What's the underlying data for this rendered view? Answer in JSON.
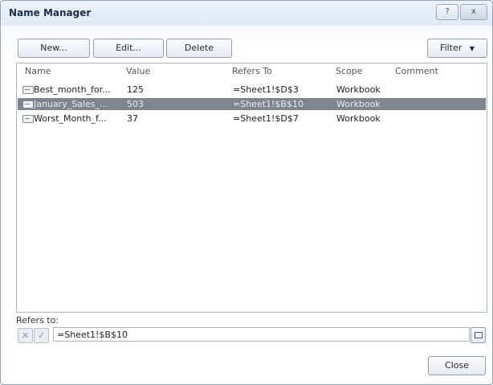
{
  "window": {
    "title": "Name Manager",
    "help_label": "?",
    "close_label": "x"
  },
  "toolbar": {
    "new_label": "New...",
    "edit_label": "Edit...",
    "delete_label": "Delete",
    "filter_label": "Filter"
  },
  "list": {
    "headers": {
      "name": "Name",
      "value": "Value",
      "refers_to": "Refers To",
      "scope": "Scope",
      "comment": "Comment"
    },
    "rows": [
      {
        "name": "Best_month_for...",
        "value": "125",
        "refers_to": "=Sheet1!$D$3",
        "scope": "Workbook",
        "comment": "",
        "selected": false
      },
      {
        "name": "January_Sales_...",
        "value": "503",
        "refers_to": "=Sheet1!$B$10",
        "scope": "Workbook",
        "comment": "",
        "selected": true
      },
      {
        "name": "Worst_Month_f...",
        "value": "37",
        "refers_to": "=Sheet1!$D$7",
        "scope": "Workbook",
        "comment": "",
        "selected": false
      }
    ]
  },
  "refers_to": {
    "label": "Refers to:",
    "value": "=Sheet1!$B$10"
  },
  "footer": {
    "close_label": "Close"
  }
}
